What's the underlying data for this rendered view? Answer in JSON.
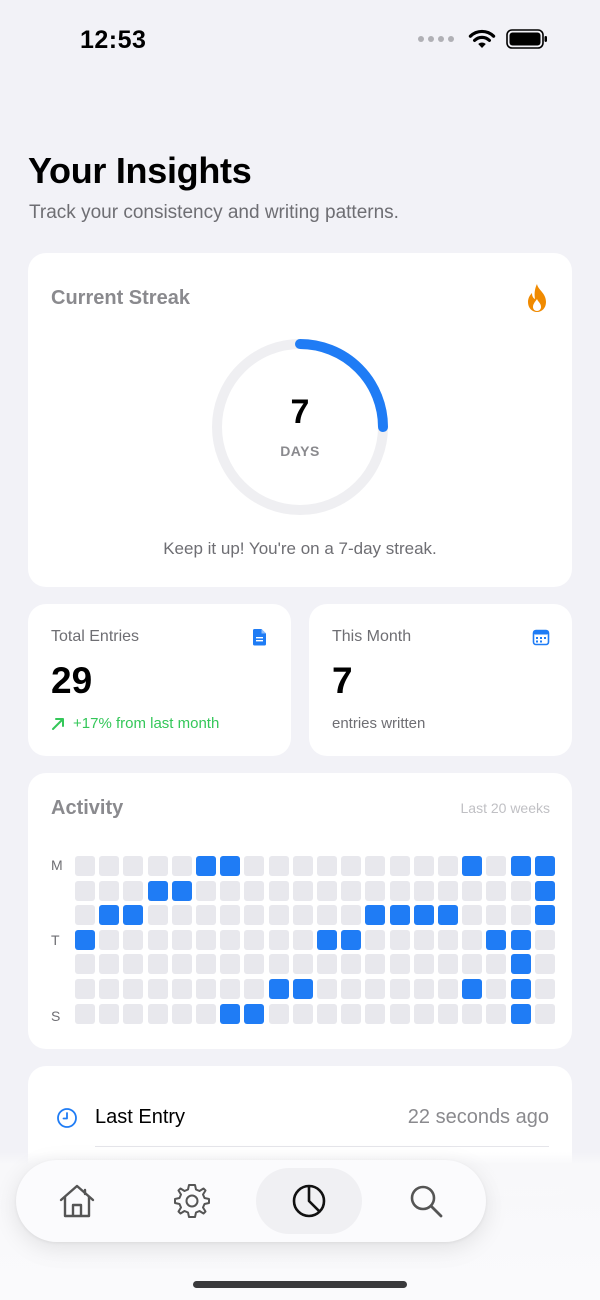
{
  "status_bar": {
    "time": "12:53"
  },
  "header": {
    "title": "Your Insights",
    "subtitle": "Track your consistency and writing patterns."
  },
  "streak": {
    "title": "Current Streak",
    "value": "7",
    "unit": "DAYS",
    "message": "Keep it up! You're on a 7-day streak.",
    "progress": 0.25,
    "accent_color": "#1f7cf5",
    "icon": "flame-icon",
    "icon_color": "#f08a00"
  },
  "stats": {
    "total_entries": {
      "label": "Total Entries",
      "value": "29",
      "change": "+17% from last month",
      "icon": "document-icon"
    },
    "this_month": {
      "label": "This Month",
      "value": "7",
      "caption": "entries written",
      "icon": "calendar-icon"
    }
  },
  "activity": {
    "title": "Activity",
    "range": "Last 20 weeks",
    "day_labels": [
      "M",
      "T",
      "S"
    ],
    "weeks": 20,
    "days": 7,
    "active_cells": [
      [
        0,
        5
      ],
      [
        0,
        6
      ],
      [
        0,
        16
      ],
      [
        0,
        18
      ],
      [
        0,
        19
      ],
      [
        1,
        3
      ],
      [
        1,
        4
      ],
      [
        1,
        19
      ],
      [
        2,
        1
      ],
      [
        2,
        2
      ],
      [
        2,
        12
      ],
      [
        2,
        13
      ],
      [
        2,
        14
      ],
      [
        2,
        15
      ],
      [
        2,
        19
      ],
      [
        3,
        0
      ],
      [
        3,
        10
      ],
      [
        3,
        11
      ],
      [
        3,
        17
      ],
      [
        3,
        18
      ],
      [
        4,
        18
      ],
      [
        5,
        8
      ],
      [
        5,
        9
      ],
      [
        5,
        16
      ],
      [
        5,
        18
      ],
      [
        6,
        6
      ],
      [
        6,
        7
      ],
      [
        6,
        18
      ]
    ],
    "active_color": "#1f7cf5",
    "inactive_color": "#e8e8ed"
  },
  "last_entry": {
    "label": "Last Entry",
    "value": "22 seconds ago",
    "icon": "clock-icon"
  },
  "tab_bar": {
    "tabs": [
      {
        "name": "home",
        "icon": "home-icon"
      },
      {
        "name": "settings",
        "icon": "gear-icon"
      },
      {
        "name": "insights",
        "icon": "pie-chart-icon",
        "active": true
      },
      {
        "name": "search",
        "icon": "search-icon"
      }
    ]
  }
}
